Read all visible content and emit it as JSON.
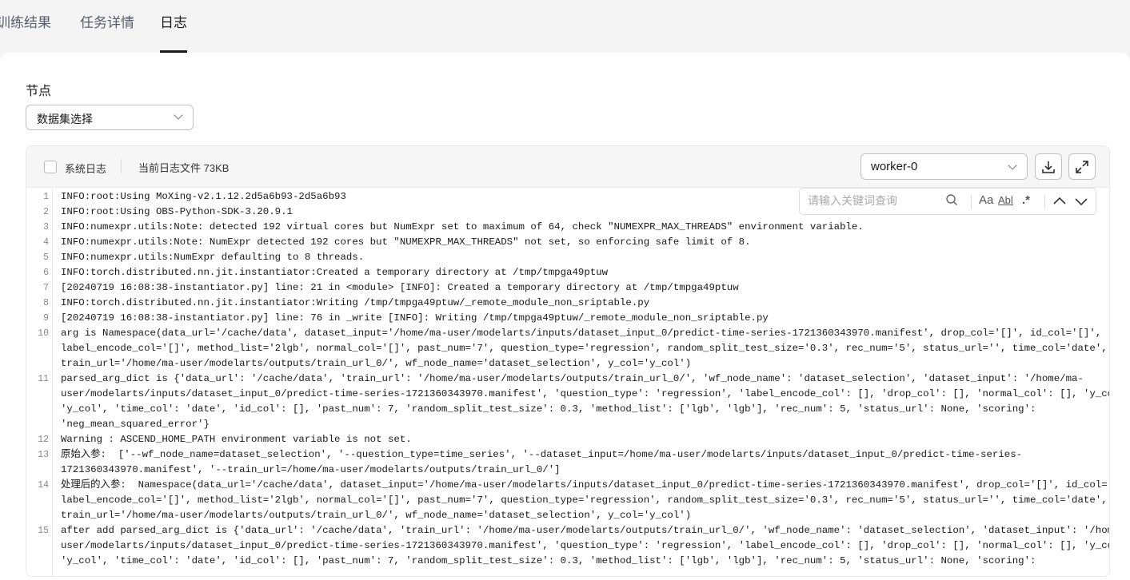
{
  "tabs": [
    "训练结果",
    "任务详情",
    "日志"
  ],
  "node": {
    "label": "节点",
    "selected": "数据集选择"
  },
  "toolbar": {
    "system_log": "系统日志",
    "file_size": "当前日志文件 73KB",
    "worker": "worker-0"
  },
  "search": {
    "placeholder": "请输入关键词查询",
    "case": "Aa",
    "word": "Abl",
    "regex": ".*"
  },
  "log": [
    {
      "n": "1",
      "lines": [
        "INFO:root:Using MoXing-v2.1.12.2d5a6b93-2d5a6b93"
      ]
    },
    {
      "n": "2",
      "lines": [
        "INFO:root:Using OBS-Python-SDK-3.20.9.1"
      ]
    },
    {
      "n": "3",
      "lines": [
        "INFO:numexpr.utils:Note: detected 192 virtual cores but NumExpr set to maximum of 64, check \"NUMEXPR_MAX_THREADS\" environment variable."
      ]
    },
    {
      "n": "4",
      "lines": [
        "INFO:numexpr.utils:Note: NumExpr detected 192 cores but \"NUMEXPR_MAX_THREADS\" not set, so enforcing safe limit of 8."
      ]
    },
    {
      "n": "5",
      "lines": [
        "INFO:numexpr.utils:NumExpr defaulting to 8 threads."
      ]
    },
    {
      "n": "6",
      "lines": [
        "INFO:torch.distributed.nn.jit.instantiator:Created a temporary directory at /tmp/tmpga49ptuw"
      ]
    },
    {
      "n": "7",
      "lines": [
        "[20240719 16:08:38-instantiator.py] line: 21 in <module> [INFO]: Created a temporary directory at /tmp/tmpga49ptuw"
      ]
    },
    {
      "n": "8",
      "lines": [
        "INFO:torch.distributed.nn.jit.instantiator:Writing /tmp/tmpga49ptuw/_remote_module_non_sriptable.py"
      ]
    },
    {
      "n": "9",
      "lines": [
        "[20240719 16:08:38-instantiator.py] line: 76 in _write [INFO]: Writing /tmp/tmpga49ptuw/_remote_module_non_sriptable.py"
      ]
    },
    {
      "n": "10",
      "lines": [
        "arg is Namespace(data_url='/cache/data', dataset_input='/home/ma-user/modelarts/inputs/dataset_input_0/predict-time-series-1721360343970.manifest', drop_col='[]', id_col='[]',",
        "label_encode_col='[]', method_list='2lgb', normal_col='[]', past_num='7', question_type='regression', random_split_test_size='0.3', rec_num='5', status_url='', time_col='date',",
        "train_url='/home/ma-user/modelarts/outputs/train_url_0/', wf_node_name='dataset_selection', y_col='y_col')"
      ]
    },
    {
      "n": "11",
      "lines": [
        "parsed_arg_dict is {'data_url': '/cache/data', 'train_url': '/home/ma-user/modelarts/outputs/train_url_0/', 'wf_node_name': 'dataset_selection', 'dataset_input': '/home/ma-",
        "user/modelarts/inputs/dataset_input_0/predict-time-series-1721360343970.manifest', 'question_type': 'regression', 'label_encode_col': [], 'drop_col': [], 'normal_col': [], 'y_col':",
        "'y_col', 'time_col': 'date', 'id_col': [], 'past_num': 7, 'random_split_test_size': 0.3, 'method_list': ['lgb', 'lgb'], 'rec_num': 5, 'status_url': None, 'scoring':",
        "'neg_mean_squared_error'}"
      ]
    },
    {
      "n": "12",
      "lines": [
        "Warning : ASCEND_HOME_PATH environment variable is not set."
      ]
    },
    {
      "n": "13",
      "lines": [
        "原始入参:  ['--wf_node_name=dataset_selection', '--question_type=time_series', '--dataset_input=/home/ma-user/modelarts/inputs/dataset_input_0/predict-time-series-",
        "1721360343970.manifest', '--train_url=/home/ma-user/modelarts/outputs/train_url_0/']"
      ]
    },
    {
      "n": "14",
      "lines": [
        "处理后的入参:  Namespace(data_url='/cache/data', dataset_input='/home/ma-user/modelarts/inputs/dataset_input_0/predict-time-series-1721360343970.manifest', drop_col='[]', id_col='[]',",
        "label_encode_col='[]', method_list='2lgb', normal_col='[]', past_num='7', question_type='regression', random_split_test_size='0.3', rec_num='5', status_url='', time_col='date',",
        "train_url='/home/ma-user/modelarts/outputs/train_url_0/', wf_node_name='dataset_selection', y_col='y_col')"
      ]
    },
    {
      "n": "15",
      "lines": [
        "after add parsed_arg_dict is {'data_url': '/cache/data', 'train_url': '/home/ma-user/modelarts/outputs/train_url_0/', 'wf_node_name': 'dataset_selection', 'dataset_input': '/home/ma-",
        "user/modelarts/inputs/dataset_input_0/predict-time-series-1721360343970.manifest', 'question_type': 'regression', 'label_encode_col': [], 'drop_col': [], 'normal_col': [], 'y_col':",
        "'y_col', 'time_col': 'date', 'id_col': [], 'past_num': 7, 'random_split_test_size': 0.3, 'method_list': ['lgb', 'lgb'], 'rec_num': 5, 'status_url': None, 'scoring':"
      ]
    }
  ]
}
